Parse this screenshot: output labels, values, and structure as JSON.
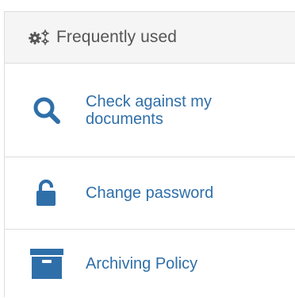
{
  "panel": {
    "header": {
      "title": "Frequently used",
      "icon": "cogs-icon"
    },
    "items": [
      {
        "label": "Check against my documents",
        "icon": "search-icon"
      },
      {
        "label": "Change password",
        "icon": "unlock-icon"
      },
      {
        "label": "Archiving Policy",
        "icon": "archive-icon"
      }
    ]
  },
  "colors": {
    "accent": "#2f6fa9",
    "header_bg": "#f5f5f5",
    "header_text": "#555555",
    "border": "#dddddd"
  }
}
